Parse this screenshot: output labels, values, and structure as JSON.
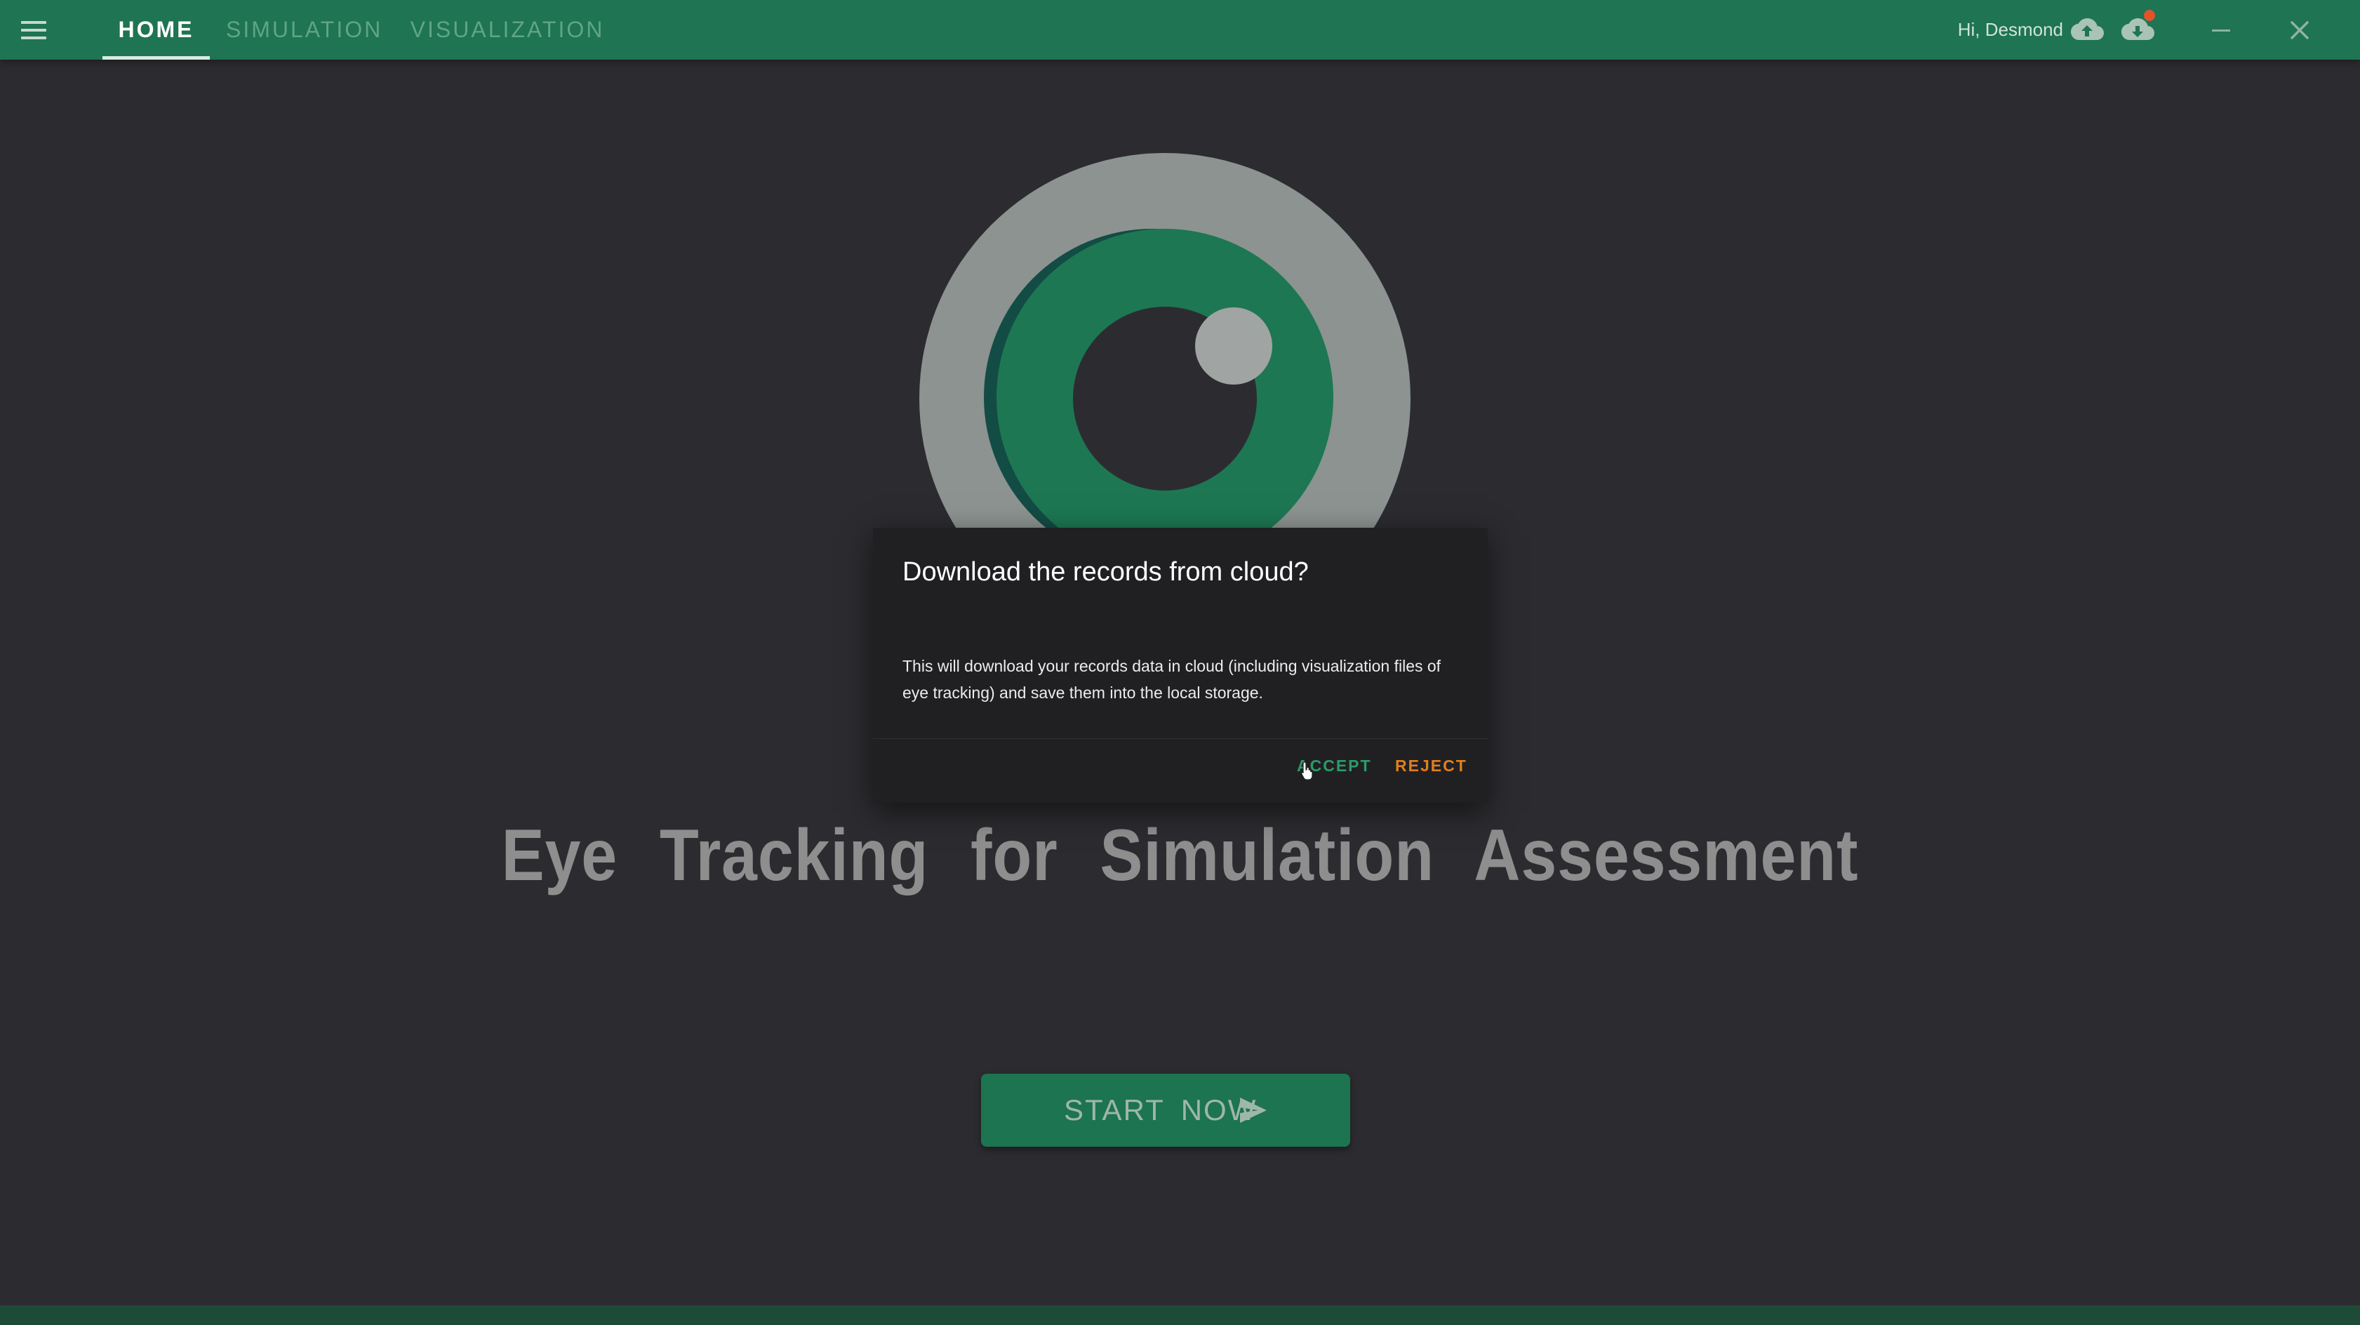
{
  "appbar": {
    "tabs": [
      {
        "label": "HOME",
        "active": true
      },
      {
        "label": "SIMULATION",
        "active": false
      },
      {
        "label": "VISUALIZATION",
        "active": false
      }
    ],
    "greeting": "Hi, Desmond",
    "icons": [
      "menu-icon",
      "cloud-upload-icon",
      "cloud-download-icon",
      "minimize-icon",
      "close-icon"
    ],
    "has_notification": true
  },
  "main": {
    "title": "Eye Tracking for Simulation Assessment",
    "start_button": "START NOW"
  },
  "dialog": {
    "title": "Download the records from cloud?",
    "body": "This will download your records data in cloud (including visualization files of eye tracking) and save them into the local storage.",
    "accept_label": "ACCEPT",
    "reject_label": "REJECT"
  },
  "colors": {
    "appbar": "#1e7453",
    "background": "#2c2c30",
    "accent_green": "#2c9b69",
    "accent_orange": "#e07f1e",
    "dialog": "#202022"
  }
}
